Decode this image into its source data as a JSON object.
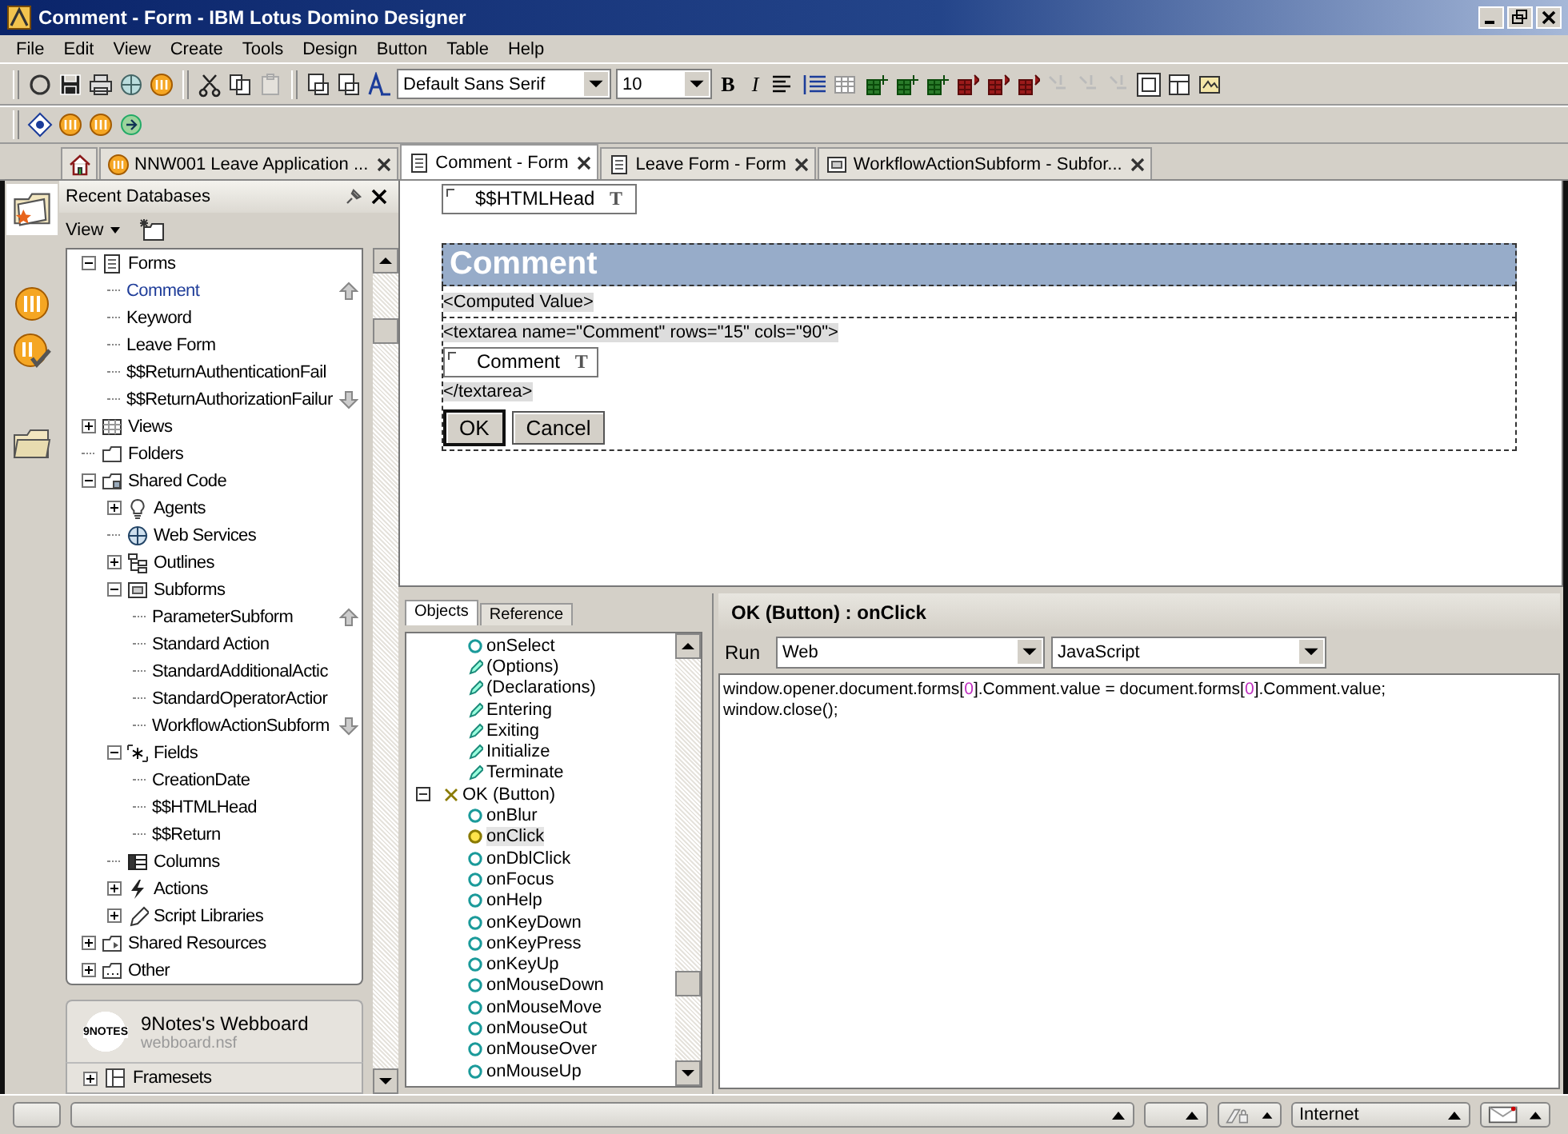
{
  "window": {
    "title": "Comment - Form - IBM Lotus Domino Designer"
  },
  "menu": [
    "File",
    "Edit",
    "View",
    "Create",
    "Tools",
    "Design",
    "Button",
    "Table",
    "Help"
  ],
  "toolbar": {
    "font": "Default Sans Serif",
    "size": "10",
    "bold": "B",
    "italic": "I"
  },
  "tabs": [
    {
      "kind": "home",
      "selected": false
    },
    {
      "kind": "database",
      "label": "NNW001 Leave Application ...",
      "selected": false
    },
    {
      "kind": "form",
      "label": "Comment - Form",
      "selected": true
    },
    {
      "kind": "form",
      "label": "Leave Form - Form",
      "selected": false
    },
    {
      "kind": "subform",
      "label": "WorkflowActionSubform - Subfor...",
      "selected": false
    }
  ],
  "navigator": {
    "title": "Recent Databases",
    "view_menu": "View",
    "tree": [
      {
        "label": "Forms",
        "kind": "form",
        "expanded": true,
        "selected": false,
        "children": [
          {
            "label": "Comment",
            "selected": true,
            "scroll_up": true
          },
          {
            "label": "Keyword",
            "selected": false
          },
          {
            "label": "Leave Form",
            "selected": false
          },
          {
            "label": "$$ReturnAuthenticationFail",
            "selected": false
          },
          {
            "label": "$$ReturnAuthorizationFailur",
            "selected": false,
            "scroll_down": true
          }
        ]
      },
      {
        "label": "Views",
        "kind": "view",
        "expanded": false,
        "selected": false
      },
      {
        "label": "Folders",
        "kind": "folder",
        "selected": false
      },
      {
        "label": "Shared Code",
        "kind": "shared",
        "expanded": true,
        "selected": false,
        "children": [
          {
            "label": "Agents",
            "kind": "agent",
            "expanded": false,
            "selected": false
          },
          {
            "label": "Web Services",
            "kind": "webservice",
            "selected": false
          },
          {
            "label": "Outlines",
            "kind": "outline",
            "expanded": false,
            "selected": false
          },
          {
            "label": "Subforms",
            "kind": "subform",
            "expanded": true,
            "selected": false,
            "children": [
              {
                "label": "ParameterSubform",
                "selected": false,
                "scroll_up": true
              },
              {
                "label": "Standard Action",
                "selected": false
              },
              {
                "label": "StandardAdditionalActic",
                "selected": false
              },
              {
                "label": "StandardOperatorActior",
                "selected": false
              },
              {
                "label": "WorkflowActionSubform",
                "selected": false,
                "scroll_down": true
              }
            ]
          },
          {
            "label": "Fields",
            "kind": "fields",
            "expanded": true,
            "selected": false,
            "children": [
              {
                "label": "CreationDate",
                "selected": false
              },
              {
                "label": "$$HTMLHead",
                "selected": false
              },
              {
                "label": "$$Return",
                "selected": false
              }
            ]
          },
          {
            "label": "Columns",
            "kind": "columns",
            "selected": false
          },
          {
            "label": "Actions",
            "kind": "actions",
            "expanded": false,
            "selected": false
          },
          {
            "label": "Script Libraries",
            "kind": "script",
            "expanded": false,
            "selected": false
          }
        ]
      },
      {
        "label": "Shared Resources",
        "kind": "resources",
        "expanded": false,
        "selected": false
      },
      {
        "label": "Other",
        "kind": "other",
        "expanded": false,
        "selected": false
      }
    ],
    "database": {
      "name": "9Notes's Webboard",
      "file": "webboard.nsf",
      "logo": "9NOTES"
    },
    "framesets": {
      "label": "Framesets",
      "expanded": false
    }
  },
  "form": {
    "header_field": {
      "label": "$$HTMLHead",
      "glyph": "T"
    },
    "table": {
      "heading": "Comment",
      "computed": "<Computed Value>",
      "body": [
        {
          "kind": "html",
          "text": "<textarea name=\"Comment\" rows=\"15\" cols=\"90\">"
        },
        {
          "kind": "field",
          "label": "Comment",
          "glyph": "T"
        },
        {
          "kind": "html",
          "text": "</textarea>"
        },
        {
          "kind": "buttons",
          "buttons": [
            "OK",
            "Cancel"
          ]
        }
      ]
    }
  },
  "objects": {
    "tabs": [
      {
        "label": "Objects",
        "selected": true
      },
      {
        "label": "Reference",
        "selected": false
      }
    ],
    "items": [
      {
        "label": "onSelect",
        "kind": "event",
        "selected": false
      },
      {
        "label": "(Options)",
        "kind": "script",
        "selected": false
      },
      {
        "label": "(Declarations)",
        "kind": "script",
        "selected": false
      },
      {
        "label": "Entering",
        "kind": "script",
        "selected": false
      },
      {
        "label": "Exiting",
        "kind": "script",
        "selected": false
      },
      {
        "label": "Initialize",
        "kind": "script",
        "selected": false
      },
      {
        "label": "Terminate",
        "kind": "script",
        "selected": false
      },
      {
        "label": "OK (Button)",
        "kind": "button",
        "expanded": true,
        "selected": false,
        "children": [
          {
            "label": "onBlur",
            "kind": "event",
            "selected": false
          },
          {
            "label": "onClick",
            "kind": "event",
            "selected": true
          },
          {
            "label": "onDblClick",
            "kind": "event",
            "selected": false
          },
          {
            "label": "onFocus",
            "kind": "event",
            "selected": false
          },
          {
            "label": "onHelp",
            "kind": "event",
            "selected": false
          },
          {
            "label": "onKeyDown",
            "kind": "event",
            "selected": false
          },
          {
            "label": "onKeyPress",
            "kind": "event",
            "selected": false
          },
          {
            "label": "onKeyUp",
            "kind": "event",
            "selected": false
          },
          {
            "label": "onMouseDown",
            "kind": "event",
            "selected": false
          },
          {
            "label": "onMouseMove",
            "kind": "event",
            "selected": false
          },
          {
            "label": "onMouseOut",
            "kind": "event",
            "selected": false
          },
          {
            "label": "onMouseOver",
            "kind": "event",
            "selected": false
          },
          {
            "label": "onMouseUp",
            "kind": "event",
            "selected": false
          }
        ]
      }
    ]
  },
  "editor": {
    "title": "OK (Button) : onClick",
    "run_label": "Run",
    "run_target": "Web",
    "language": "JavaScript",
    "lines": [
      [
        {
          "text": "window.opener.document.forms["
        },
        {
          "text": "0",
          "kind": "number"
        },
        {
          "text": "].Comment.value = document.forms["
        },
        {
          "text": "0",
          "kind": "number"
        },
        {
          "text": "].Comment.value;"
        }
      ],
      [
        {
          "text": "window.close();"
        }
      ]
    ]
  },
  "status": {
    "location": "Internet"
  }
}
